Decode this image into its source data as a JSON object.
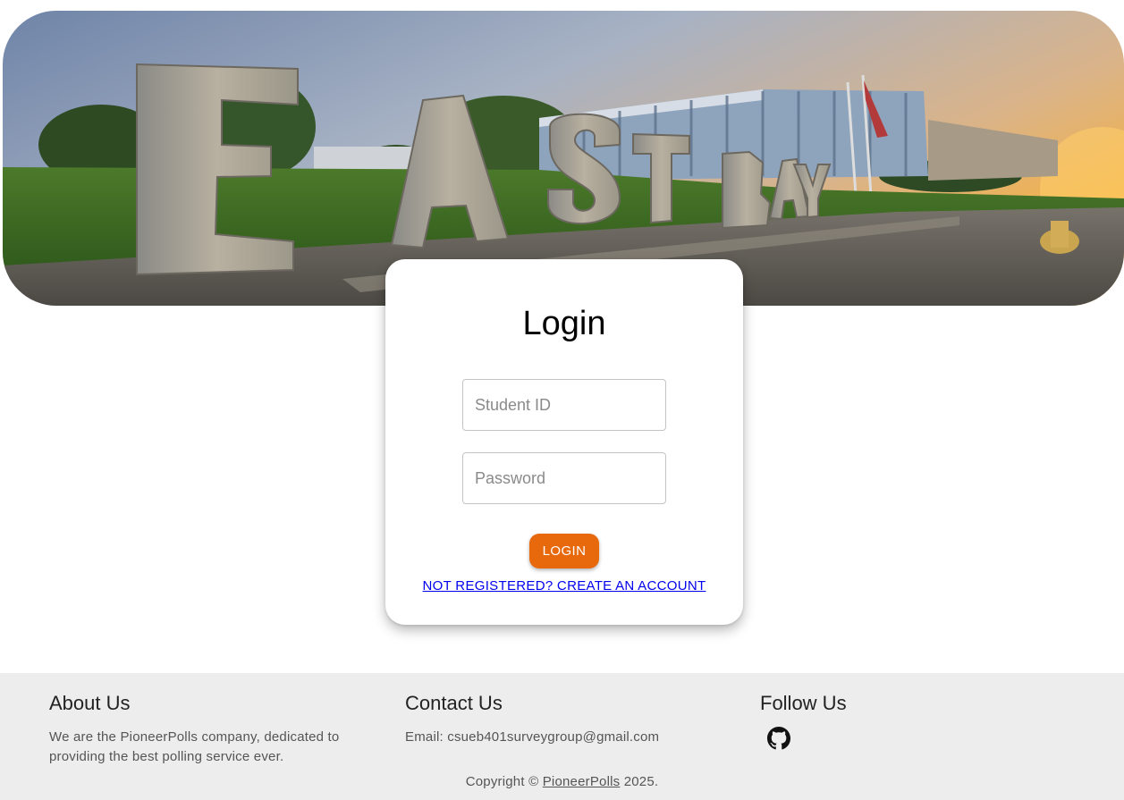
{
  "hero": {
    "letters": [
      "E",
      "A",
      "S",
      "T",
      "B",
      "A",
      "Y"
    ]
  },
  "login": {
    "title": "Login",
    "student_id_placeholder": "Student ID",
    "password_placeholder": "Password",
    "login_button": "LOGIN",
    "register_link": "NOT REGISTERED? CREATE AN ACCOUNT"
  },
  "footer": {
    "about": {
      "heading": "About Us",
      "text": "We are the PioneerPolls company, dedicated to providing the best polling service ever."
    },
    "contact": {
      "heading": "Contact Us",
      "email": "Email: csueb401surveygroup@gmail.com"
    },
    "follow": {
      "heading": "Follow Us",
      "icon": "github-icon"
    },
    "copyright_prefix": "Copyright ©",
    "copyright_brand": "PioneerPolls",
    "copyright_suffix": "2025."
  },
  "colors": {
    "accent": "#e8680c",
    "link": "#0000ee",
    "footer_bg": "#ededed"
  }
}
